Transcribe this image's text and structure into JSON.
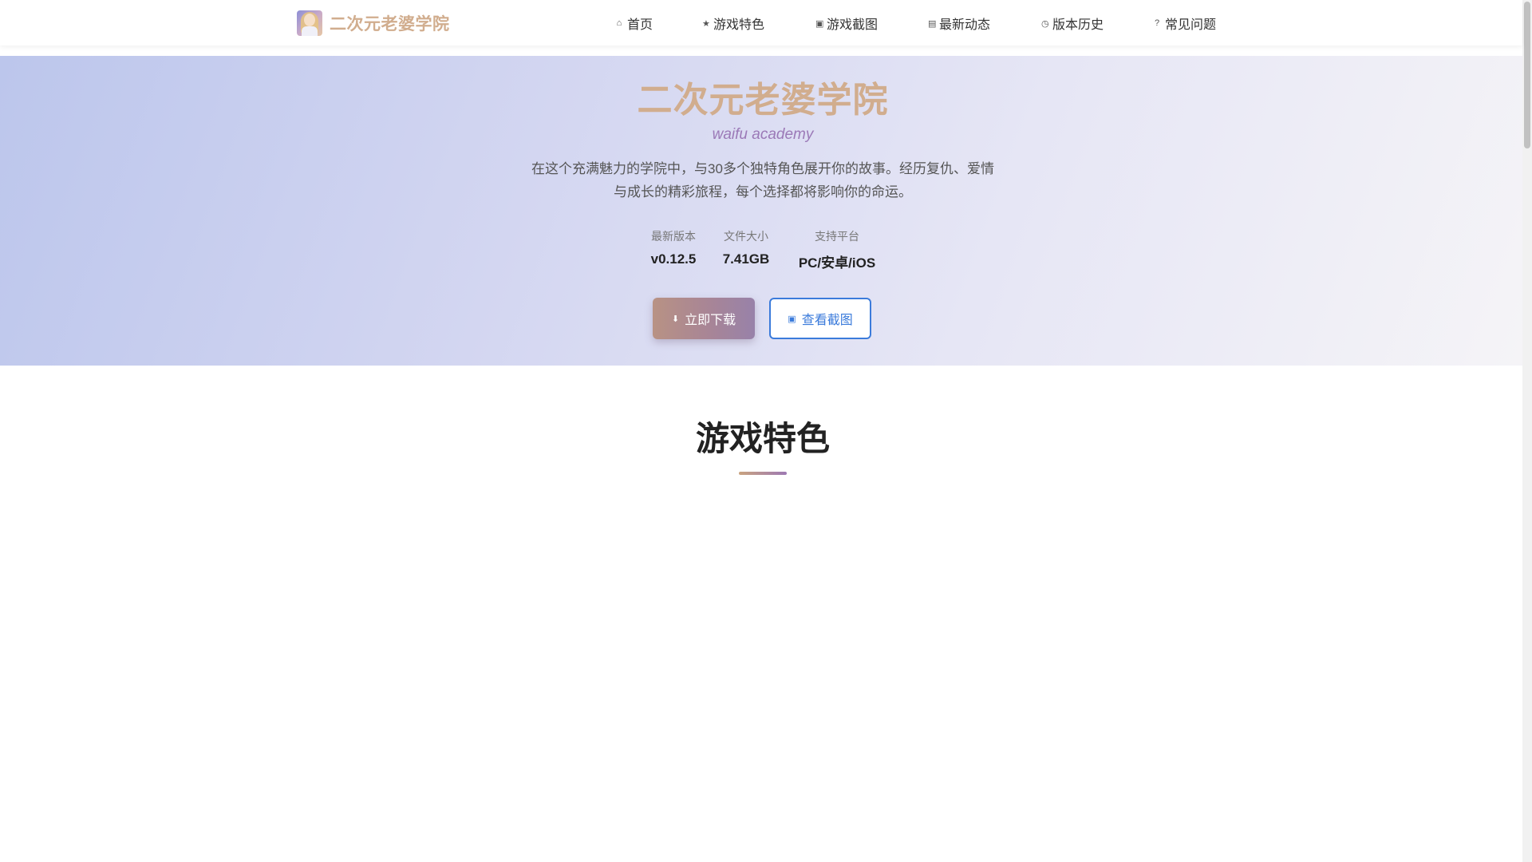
{
  "brand": {
    "name": "二次元老婆学院"
  },
  "nav": [
    {
      "id": "home",
      "label": "首页",
      "icon": "home-icon"
    },
    {
      "id": "features",
      "label": "游戏特色",
      "icon": "star-icon"
    },
    {
      "id": "screenshots",
      "label": "游戏截图",
      "icon": "image-icon"
    },
    {
      "id": "news",
      "label": "最新动态",
      "icon": "news-icon"
    },
    {
      "id": "history",
      "label": "版本历史",
      "icon": "history-icon"
    },
    {
      "id": "faq",
      "label": "常见问题",
      "icon": "question-icon"
    }
  ],
  "hero": {
    "title": "二次元老婆学院",
    "subtitle": "waifu academy",
    "description": "在这个充满魅力的学院中，与30多个独特角色展开你的故事。经历复仇、爱情与成长的精彩旅程，每个选择都将影响你的命运。",
    "stats": [
      {
        "label": "最新版本",
        "value": "v0.12.5"
      },
      {
        "label": "文件大小",
        "value": "7.41GB"
      },
      {
        "label": "支持平台",
        "value": "PC/安卓/iOS"
      }
    ],
    "download_label": "立即下载",
    "screens_label": "查看截图"
  },
  "features_section": {
    "title": "游戏特色"
  },
  "colors": {
    "brand": "#d1ad8e",
    "accent_purple": "#9b79b7",
    "link_blue": "#3b7bdb"
  }
}
